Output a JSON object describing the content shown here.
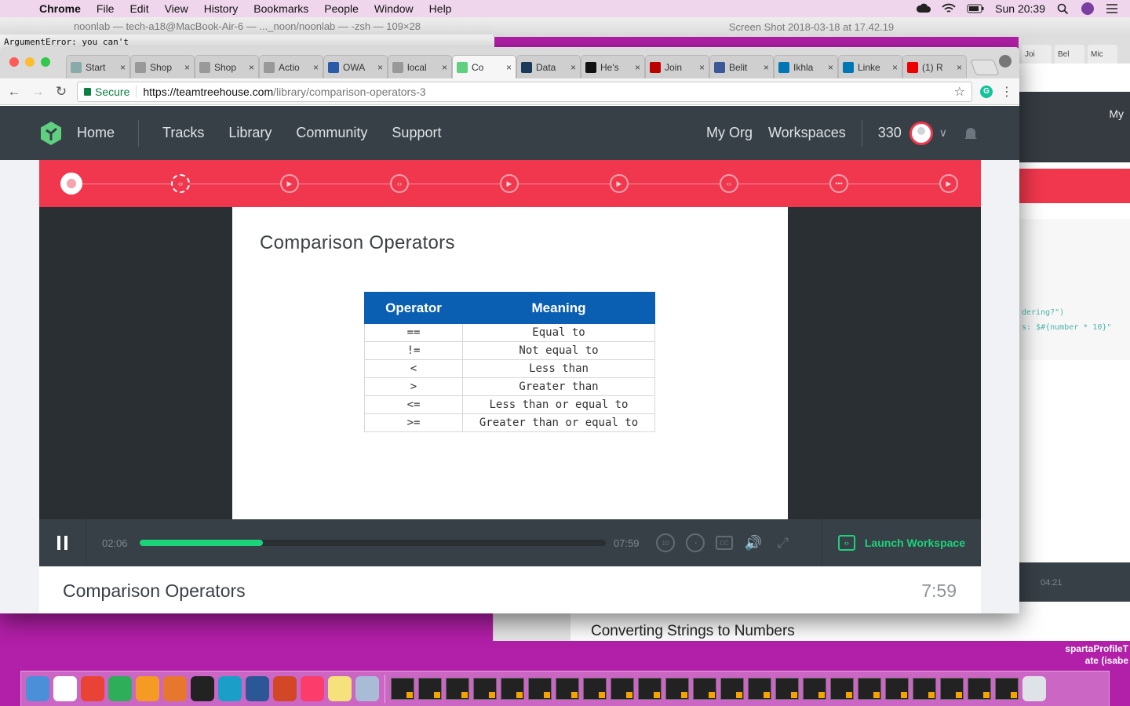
{
  "menubar": {
    "app": "Chrome",
    "items": [
      "File",
      "Edit",
      "View",
      "History",
      "Bookmarks",
      "People",
      "Window",
      "Help"
    ],
    "clock": "Sun 20:39"
  },
  "background": {
    "terminal_title": "noonlab — tech-a18@MacBook-Air-6 — ..._noon/noonlab — -zsh — 109×28",
    "terminal_line": "ArgumentError: you can't",
    "screenshot_title": "Screen Shot 2018-03-18 at 17.42.19",
    "right_tabs": [
      "Joi",
      "Bel",
      "Mic"
    ],
    "right_nav_text": "My",
    "right_code_1": "dering?\")",
    "right_code_2": "s: $#{number * 10}\"",
    "right_time": "04:21",
    "lower_title": "Converting Strings to Numbers",
    "sparta_line1": "spartaProfileT",
    "sparta_line2": "ate (isabe"
  },
  "chrome": {
    "tabs": [
      {
        "label": "Start",
        "color": "#8aa"
      },
      {
        "label": "Shop",
        "color": "#999"
      },
      {
        "label": "Shop",
        "color": "#999"
      },
      {
        "label": "Actio",
        "color": "#999"
      },
      {
        "label": "OWA",
        "color": "#2a5aa8"
      },
      {
        "label": "local",
        "color": "#999"
      },
      {
        "label": "Co",
        "color": "#5fcf80"
      },
      {
        "label": "Data",
        "color": "#1a3a5a"
      },
      {
        "label": "He's",
        "color": "#111"
      },
      {
        "label": "Join",
        "color": "#b00"
      },
      {
        "label": "Belit",
        "color": "#3b5998"
      },
      {
        "label": "Ikhla",
        "color": "#0077b5"
      },
      {
        "label": "Linke",
        "color": "#0077b5"
      },
      {
        "label": "(1) R",
        "color": "#e00"
      }
    ],
    "secure_label": "Secure",
    "url_host": "https://teamtreehouse.com",
    "url_path": "/library/comparison-operators-3"
  },
  "nav": {
    "home": "Home",
    "links": [
      "Tracks",
      "Library",
      "Community",
      "Support"
    ],
    "my_org": "My Org",
    "workspaces": "Workspaces",
    "points": "330"
  },
  "slide": {
    "title": "Comparison Operators",
    "table_headers": [
      "Operator",
      "Meaning"
    ],
    "rows": [
      [
        "==",
        "Equal to"
      ],
      [
        "!=",
        "Not equal to"
      ],
      [
        "<",
        "Less than"
      ],
      [
        ">",
        "Greater than"
      ],
      [
        "<=",
        "Less than or equal to"
      ],
      [
        ">=",
        "Greater than or equal to"
      ]
    ]
  },
  "player": {
    "current_time": "02:06",
    "total_time": "07:59",
    "progress": 0.265,
    "launch_label": "Launch Workspace",
    "accent_color": "#1cd27b"
  },
  "video": {
    "title": "Comparison Operators",
    "duration": "7:59"
  }
}
